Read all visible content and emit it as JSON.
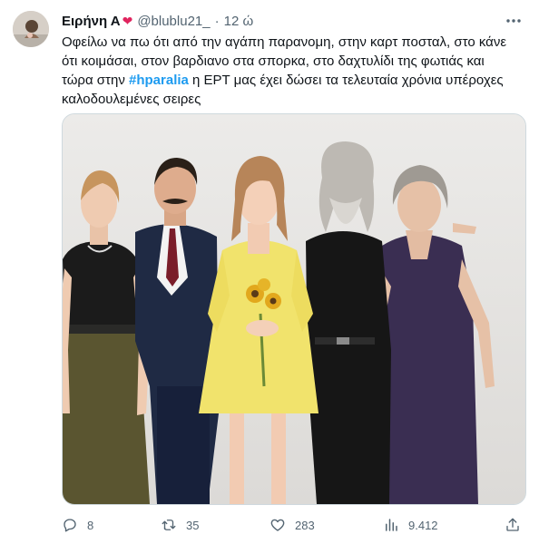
{
  "user": {
    "name": "Ειρήνη Α",
    "name_emoji": "❤",
    "handle": "@blublu21_",
    "separator": "·",
    "time": "12 ώ"
  },
  "tweet": {
    "text_before": "Οφείλω να πω ότι από την αγάπη παρανομη, στην καρτ ποσταλ, στο κάνε ότι κοιμάσαι, στον βαρδιανο στα σπορκα, στο δαχτυλίδι της φωτιάς και τώρα στην ",
    "hashtag": "#hparalia",
    "text_after": " η ΕΡΤ μας έχει δώσει τα τελευταία χρόνια υπέροχες καλοδουλεμένες σειρες"
  },
  "metrics": {
    "replies": "8",
    "retweets": "35",
    "likes": "283",
    "views": "9.412"
  },
  "icons": [
    "more-icon",
    "reply-icon",
    "retweet-icon",
    "like-icon",
    "views-icon",
    "share-icon"
  ],
  "colors": {
    "accent": "#1d9bf0",
    "muted": "#536471",
    "heart": "#e0245e"
  }
}
